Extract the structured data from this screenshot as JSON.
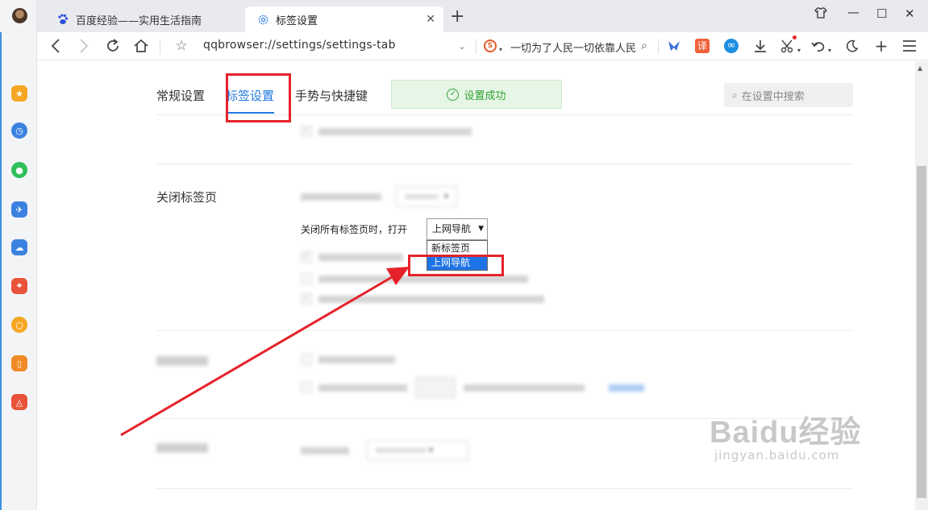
{
  "tabs": [
    {
      "label": "百度经验——实用生活指南",
      "icon": "baidu-paw-icon"
    },
    {
      "label": "标签设置",
      "icon": "gear-icon",
      "close": "✕"
    }
  ],
  "toolbar": {
    "url": "qqbrowser://settings/settings-tab",
    "search_text": "一切为了人民一切依靠人民",
    "translate_label": "译"
  },
  "settings": {
    "tabs": [
      "常规设置",
      "标签设置",
      "手势与快捷键"
    ],
    "active_tab": 1,
    "success_message": "设置成功",
    "search_placeholder": "在设置中搜索",
    "close_section_title": "关闭标签页",
    "close_all_label": "关闭所有标签页时，打开",
    "close_all_value": "上网导航",
    "dropdown_options": [
      "新标签页",
      "上网导航"
    ],
    "highlighted_option": 1
  },
  "watermark": {
    "brand": "Baidu经验",
    "domain": "jingyan.baidu.com"
  },
  "colors": {
    "accent": "#1f7ae0",
    "success": "#33a033",
    "annotation": "#e5222b",
    "highlight": "#1e73e6"
  }
}
